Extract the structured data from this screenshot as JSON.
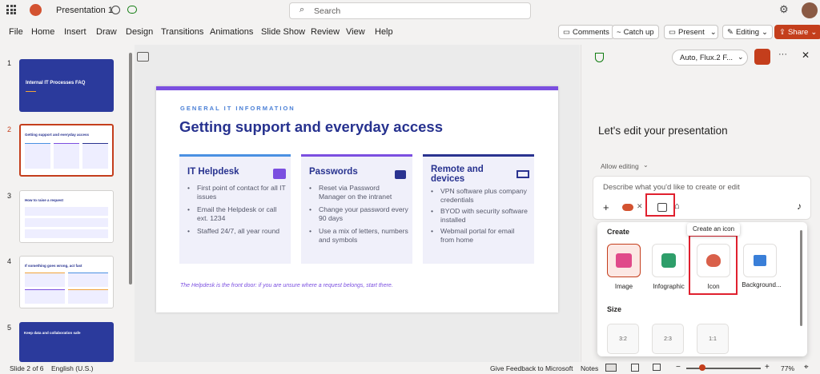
{
  "titlebar": {
    "doc_title": "Presentation 1",
    "search_placeholder": "Search"
  },
  "menu": [
    "File",
    "Home",
    "Insert",
    "Draw",
    "Design",
    "Transitions",
    "Animations",
    "Slide Show",
    "Review",
    "View",
    "Help"
  ],
  "toolbar": {
    "comments": "Comments",
    "catchup": "Catch up",
    "present": "Present",
    "editing": "Editing",
    "share": "Share"
  },
  "thumbnails": [
    {
      "num": "1",
      "title": "Internal IT Processes FAQ"
    },
    {
      "num": "2",
      "title": "Getting support and everyday access"
    },
    {
      "num": "3",
      "title": "How to raise a request"
    },
    {
      "num": "4",
      "title": "If something goes wrong, act fast"
    },
    {
      "num": "5",
      "title": "Keep data and collaboration safe"
    }
  ],
  "slide": {
    "eyebrow": "GENERAL IT INFORMATION",
    "title": "Getting support and everyday access",
    "cards": [
      {
        "title": "IT Helpdesk",
        "bullets": [
          "First point of contact for all IT issues",
          "Email the Helpdesk or call ext. 1234",
          "Staffed 24/7, all year round"
        ]
      },
      {
        "title": "Passwords",
        "bullets": [
          "Reset via Password Manager on the intranet",
          "Change your password every 90 days",
          "Use a mix of letters, numbers and symbols"
        ]
      },
      {
        "title": "Remote and devices",
        "bullets": [
          "VPN software plus company credentials",
          "BYOD with security software installed",
          "Webmail portal for email from home"
        ]
      }
    ],
    "footer": "The Helpdesk is the front door: if you are unsure where a request belongs, start there."
  },
  "copilot": {
    "model": "Auto, Flux.2 F...",
    "heading": "Let's edit your presentation",
    "allow": "Allow editing",
    "input_placeholder": "Describe what you'd like to create or edit",
    "tooltip": "Create an icon",
    "create_label": "Create",
    "tiles": [
      "Image",
      "Infographic",
      "Icon",
      "Background..."
    ],
    "size_label": "Size",
    "sizes": [
      "3:2",
      "2:3",
      "1:1"
    ]
  },
  "status": {
    "slide": "Slide 2 of 6",
    "lang": "English (U.S.)",
    "feedback": "Give Feedback to Microsoft",
    "notes": "Notes",
    "zoom": "77%"
  },
  "colors": {
    "accent_purple": "#7b4fe0",
    "accent_blue": "#4a90e2",
    "navy": "#2a3390",
    "red": "#c43e1c"
  }
}
